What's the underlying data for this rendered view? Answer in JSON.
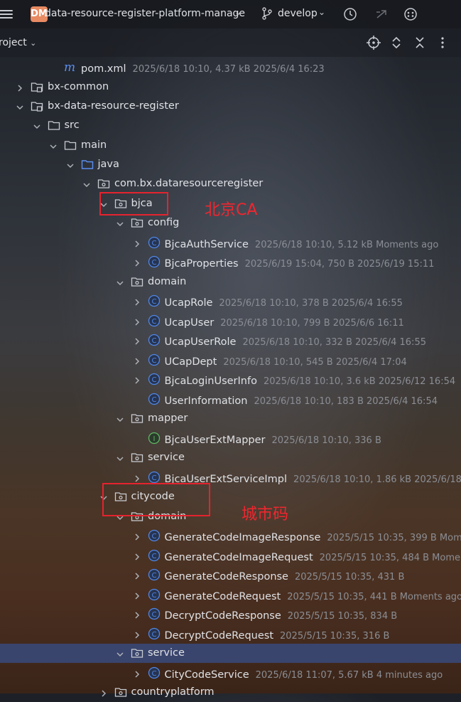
{
  "topbar": {
    "project_badge": "DM",
    "project_name": "data-resource-register-platform-manage",
    "branch": "develop"
  },
  "panel": {
    "title": "roject"
  },
  "tree": [
    {
      "label": "pom.xml",
      "meta": "2025/6/18 10:10, 4.37 kB 2025/6/4 16:23",
      "icon": "maven-icon",
      "chevron": "none"
    },
    {
      "label": "bx-common",
      "meta": "",
      "icon": "module-folder-icon",
      "chevron": "right"
    },
    {
      "label": "bx-data-resource-register",
      "meta": "",
      "icon": "module-folder-icon",
      "chevron": "down"
    },
    {
      "label": "src",
      "meta": "",
      "icon": "folder-icon",
      "chevron": "down"
    },
    {
      "label": "main",
      "meta": "",
      "icon": "folder-icon",
      "chevron": "down"
    },
    {
      "label": "java",
      "meta": "",
      "icon": "source-folder-icon",
      "chevron": "down"
    },
    {
      "label": "com.bx.dataresourceregister",
      "meta": "",
      "icon": "package-icon",
      "chevron": "down"
    },
    {
      "label": "bjca",
      "meta": "",
      "icon": "package-icon",
      "chevron": "down"
    },
    {
      "label": "config",
      "meta": "",
      "icon": "package-icon",
      "chevron": "down"
    },
    {
      "label": "BjcaAuthService",
      "meta": "2025/6/18 10:10, 5.12 kB Moments ago",
      "icon": "class-icon",
      "chevron": "right"
    },
    {
      "label": "BjcaProperties",
      "meta": "2025/6/19 15:04, 750 B 2025/6/19 15:11",
      "icon": "class-icon",
      "chevron": "right"
    },
    {
      "label": "domain",
      "meta": "",
      "icon": "package-icon",
      "chevron": "down"
    },
    {
      "label": "UcapRole",
      "meta": "2025/6/18 10:10, 378 B 2025/6/4 16:55",
      "icon": "class-icon",
      "chevron": "right"
    },
    {
      "label": "UcapUser",
      "meta": "2025/6/18 10:10, 799 B 2025/6/6 16:11",
      "icon": "class-icon",
      "chevron": "right"
    },
    {
      "label": "UcapUserRole",
      "meta": "2025/6/18 10:10, 332 B 2025/6/4 16:55",
      "icon": "class-icon",
      "chevron": "right"
    },
    {
      "label": "UCapDept",
      "meta": "2025/6/18 10:10, 545 B 2025/6/4 17:04",
      "icon": "class-icon",
      "chevron": "right"
    },
    {
      "label": "BjcaLoginUserInfo",
      "meta": "2025/6/18 10:10, 3.6 kB 2025/6/12 16:54",
      "icon": "class-icon",
      "chevron": "right"
    },
    {
      "label": "UserInformation",
      "meta": "2025/6/18 10:10, 183 B 2025/6/4 16:54",
      "icon": "class-icon",
      "chevron": "none"
    },
    {
      "label": "mapper",
      "meta": "",
      "icon": "package-icon",
      "chevron": "down"
    },
    {
      "label": "BjcaUserExtMapper",
      "meta": "2025/6/18 10:10, 336 B",
      "icon": "interface-icon",
      "chevron": "none"
    },
    {
      "label": "service",
      "meta": "",
      "icon": "package-icon",
      "chevron": "down"
    },
    {
      "label": "BjcaUserExtServiceImpl",
      "meta": "2025/6/18 10:10, 1.86 kB 2025/6/18 11:",
      "icon": "class-icon",
      "chevron": "right"
    },
    {
      "label": "citycode",
      "meta": "",
      "icon": "package-icon",
      "chevron": "down"
    },
    {
      "label": "domain",
      "meta": "",
      "icon": "package-icon",
      "chevron": "down"
    },
    {
      "label": "GenerateCodeImageResponse",
      "meta": "2025/5/15 10:35, 399 B Momen",
      "icon": "class-icon",
      "chevron": "right"
    },
    {
      "label": "GenerateCodeImageRequest",
      "meta": "2025/5/15 10:35, 484 B Moments",
      "icon": "class-icon",
      "chevron": "right"
    },
    {
      "label": "GenerateCodeResponse",
      "meta": "2025/5/15 10:35, 431 B",
      "icon": "class-icon",
      "chevron": "right"
    },
    {
      "label": "GenerateCodeRequest",
      "meta": "2025/5/15 10:35, 441 B Moments ago",
      "icon": "class-icon",
      "chevron": "right"
    },
    {
      "label": "DecryptCodeResponse",
      "meta": "2025/5/15 10:35, 834 B",
      "icon": "class-icon",
      "chevron": "right"
    },
    {
      "label": "DecryptCodeRequest",
      "meta": "2025/5/15 10:35, 316 B",
      "icon": "class-icon",
      "chevron": "right"
    },
    {
      "label": "service",
      "meta": "",
      "icon": "package-icon",
      "chevron": "down"
    },
    {
      "label": "CityCodeService",
      "meta": "2025/6/18 11:07, 5.67 kB 4 minutes ago",
      "icon": "class-icon",
      "chevron": "right"
    },
    {
      "label": "countryplatform",
      "meta": "",
      "icon": "package-icon",
      "chevron": "right"
    }
  ],
  "annotations": [
    {
      "text": "北京CA"
    },
    {
      "text": "城市码"
    }
  ],
  "colors": {
    "class_icon": "#4f86e8",
    "interface_icon": "#5fb865",
    "annotation": "#e5232e",
    "selection": "#384c82"
  }
}
